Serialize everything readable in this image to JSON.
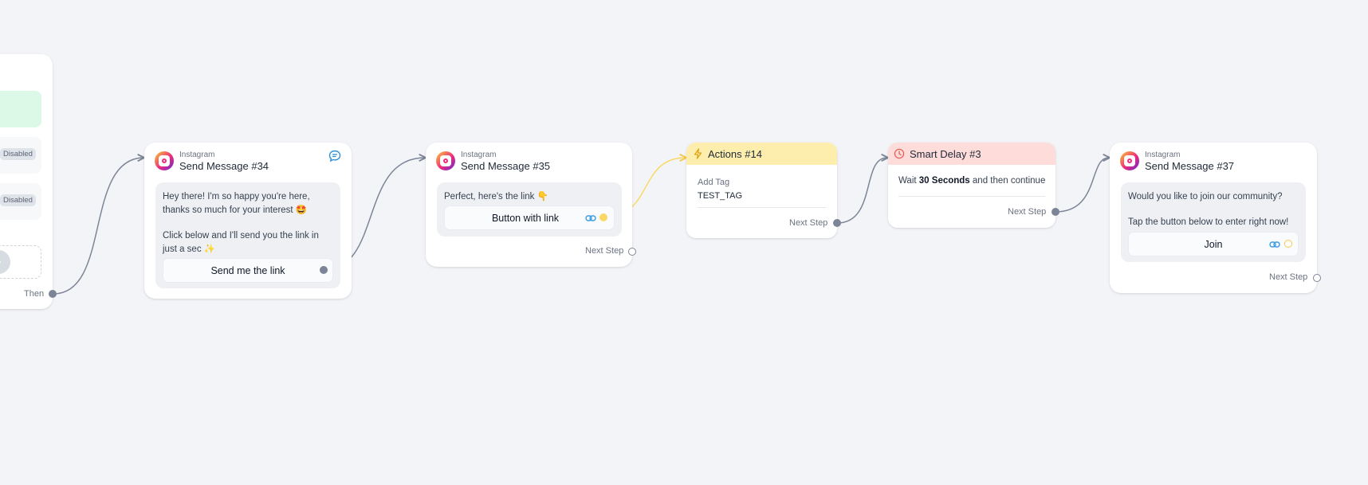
{
  "left_card": {
    "option_1_status": "Disabled",
    "option_2_status": "Disabled",
    "then_label": "Then"
  },
  "nodes": {
    "msg34": {
      "platform": "Instagram",
      "title": "Send Message #34",
      "text_lines": [
        "Hey there! I'm so happy you're here,",
        "thanks so much for your interest 🤩"
      ],
      "text_lines_2": [
        "Click below and I'll send you the link in",
        "just a sec ✨"
      ],
      "button_label": "Send me the link"
    },
    "msg35": {
      "platform": "Instagram",
      "title": "Send Message #35",
      "text": "Perfect, here's the link 👇",
      "button_label": "Button with link",
      "next_step": "Next Step"
    },
    "actions14": {
      "title": "Actions #14",
      "action_label": "Add Tag",
      "action_value": "TEST_TAG",
      "next_step": "Next Step"
    },
    "delay3": {
      "title": "Smart Delay #3",
      "text_prefix": "Wait ",
      "text_bold": "30 Seconds",
      "text_suffix": " and then continue",
      "next_step": "Next Step"
    },
    "msg37": {
      "platform": "Instagram",
      "title": "Send Message #37",
      "text_line_1": "Would you like to join our community?",
      "text_line_2": "Tap the button below to enter right now!",
      "button_label": "Join",
      "next_step": "Next Step"
    }
  },
  "icons": {
    "instagram": "instagram-icon",
    "chat": "chat-bubble-icon",
    "link": "link-icon",
    "lightning": "lightning-icon",
    "clock": "clock-icon",
    "chevron": "chevron-right-icon"
  },
  "colors": {
    "background": "#f3f4f7",
    "connector": "#7c8597",
    "connector_link": "#fbd865",
    "actions_header": "#fdeeae",
    "delay_header": "#fddcda",
    "green_option": "#dcf8e6",
    "link_icon": "#3b9be0"
  }
}
